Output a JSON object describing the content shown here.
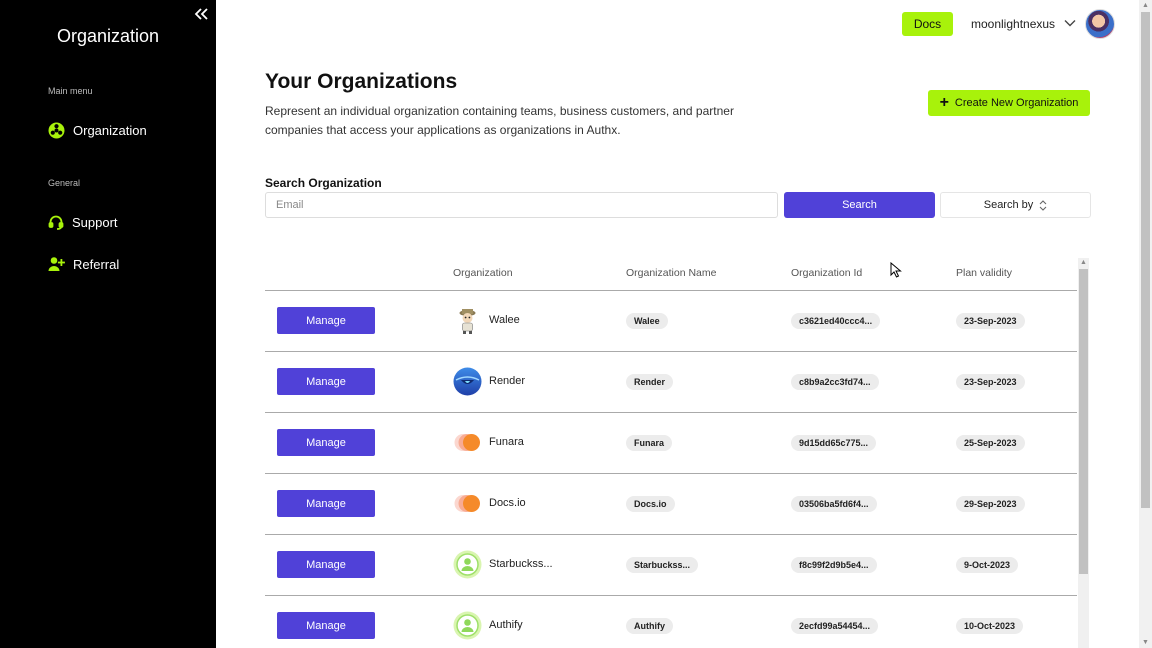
{
  "sidebar": {
    "brand": "Organization",
    "collapse_icon": "double-chevron-left-icon",
    "sections": [
      {
        "label": "Main menu",
        "items": [
          {
            "label": "Organization",
            "icon": "biohazard-icon",
            "active": true
          }
        ]
      },
      {
        "label": "General",
        "items": [
          {
            "label": "Support",
            "icon": "headset-icon"
          },
          {
            "label": "Referral",
            "icon": "user-plus-icon"
          }
        ]
      }
    ],
    "accent_color": "#a8f20b"
  },
  "topbar": {
    "docs_label": "Docs",
    "username": "moonlightnexus",
    "chevron_icon": "chevron-down-icon"
  },
  "header": {
    "title": "Your Organizations",
    "description": "Represent an individual organization containing teams, business customers, and partner companies that access your applications as organizations in Authx.",
    "create_label": "Create New Organization"
  },
  "search": {
    "label": "Search Organization",
    "placeholder": "Email",
    "value": "",
    "button_label": "Search",
    "search_by_label": "Search by"
  },
  "table": {
    "columns": [
      "Organization",
      "Organization Name",
      "Organization Id",
      "Plan validity"
    ],
    "manage_label": "Manage",
    "rows": [
      {
        "org": "Walee",
        "name": "Walee",
        "id": "c3621ed40ccc4...",
        "plan": "23-Sep-2023",
        "logo": "character-logo"
      },
      {
        "org": "Render",
        "name": "Render",
        "id": "c8b9a2cc3fd74...",
        "plan": "23-Sep-2023",
        "logo": "globe-logo"
      },
      {
        "org": "Funara",
        "name": "Funara",
        "id": "9d15dd65c775...",
        "plan": "25-Sep-2023",
        "logo": "circles-logo"
      },
      {
        "org": "Docs.io",
        "name": "Docs.io",
        "id": "03506ba5fd6f4...",
        "plan": "29-Sep-2023",
        "logo": "circles-logo"
      },
      {
        "org": "Starbuckss...",
        "name": "Starbuckss...",
        "id": "f8c99f2d9b5e4...",
        "plan": "9-Oct-2023",
        "logo": "user-logo"
      },
      {
        "org": "Authify",
        "name": "Authify",
        "id": "2ecfd99a54454...",
        "plan": "10-Oct-2023",
        "logo": "user-logo"
      }
    ]
  },
  "colors": {
    "primary": "#5041d8",
    "accent": "#a8f20b",
    "sidebar_bg": "#000000"
  }
}
